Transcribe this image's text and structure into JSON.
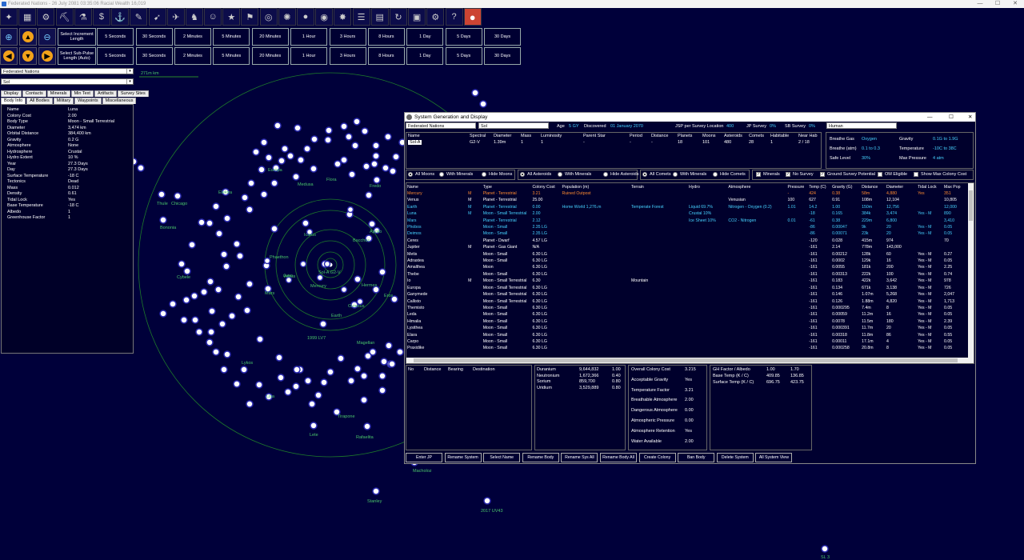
{
  "titlebar": {
    "title": "Federated Nations - 26 July 2081 03:35:06  Racial Wealth 16,019",
    "min": "—",
    "max": "☐",
    "close": "✕"
  },
  "toolbar": {
    "icons": [
      "galaxy-icon",
      "colonies-icon",
      "industry-icon",
      "mining-icon",
      "research-icon",
      "wealth-icon",
      "shipyard-icon",
      "class-design-icon",
      "missile-design-icon",
      "fleet-icon",
      "ground-forces-icon",
      "commanders-icon",
      "medals-icon",
      "intelligence-icon",
      "system-view-icon",
      "galactic-map-icon",
      "planet-icon",
      "habitable-worlds-icon",
      "combat-icon",
      "events-icon",
      "calendar-icon",
      "refresh-icon",
      "save-icon",
      "settings-icon",
      "help-icon",
      "exit-icon"
    ]
  },
  "increment_row": {
    "label": "Select Increment Length",
    "times": [
      "5 Seconds",
      "30 Seconds",
      "2 Minutes",
      "5 Minutes",
      "20 Minutes",
      "1 Hour",
      "3 Hours",
      "8 Hours",
      "1 Day",
      "5 Days",
      "30 Days"
    ]
  },
  "subpulse_row": {
    "label": "Select Sub-Pulse Length (Auto)",
    "times": [
      "5 Seconds",
      "30 Seconds",
      "2 Minutes",
      "5 Minutes",
      "20 Minutes",
      "1 Hour",
      "3 Hours",
      "8 Hours",
      "1 Day",
      "5 Days",
      "30 Days"
    ]
  },
  "left": {
    "race_select": "Federated Nations",
    "system_select": "Sol",
    "tabs_row1": [
      "Display",
      "Contacts",
      "Minerals",
      "Min Text",
      "Artifacts",
      "Survey Sites"
    ],
    "tabs_row2": [
      "Body Info",
      "All Bodies",
      "Military",
      "Waypoints",
      "Miscellaneous"
    ],
    "body_info": [
      [
        "Name",
        "Luna"
      ],
      [
        "Colony Cost",
        "2.00"
      ],
      [
        "Body Type",
        "Moon - Small Terrestrial"
      ],
      [
        "Diameter",
        "3,474 km"
      ],
      [
        "Orbital Distance",
        "384,400 km"
      ],
      [
        "Gravity",
        "0.2 G"
      ],
      [
        "Atmosphere",
        "None"
      ],
      [
        "Hydrosphere",
        "Crustal"
      ],
      [
        "Hydro Extent",
        "10 %"
      ],
      [
        "Year",
        "27.3 Days"
      ],
      [
        "Day",
        "27.3 Days"
      ],
      [
        "Surface Temperature",
        "-18 C"
      ],
      [
        "Tectonics",
        "Dead"
      ],
      [
        "Mass",
        "0.012"
      ],
      [
        "Density",
        "0.61"
      ],
      [
        "Tidal Lock",
        "Yes"
      ],
      [
        "Base Temperature",
        "-18 C"
      ],
      [
        "Albedo",
        "1"
      ],
      [
        "Greenhouse Factor",
        "1"
      ]
    ]
  },
  "map": {
    "scale_label": "271m km",
    "center_label": "Sol-A G2-V",
    "planet_labels": [
      "Mercury",
      "Venus",
      "Earth",
      "Mars",
      "Magellan",
      "1999 LV7",
      "Croesus",
      "Juno",
      "Phaethon",
      "Icarus",
      "Apollo",
      "Bacchus",
      "Hermes",
      "Eros"
    ],
    "labels_far": [
      "Thule",
      "Chicago",
      "Bononia",
      "Cybele",
      "Elektra",
      "Medusa",
      "Flora",
      "Fredo",
      "Lete",
      "Rafaelita",
      "Tirapone",
      "2017 UV43",
      "Stanley",
      "SL 3",
      "Macholoz",
      "Lykos",
      "Lisa",
      "Europa"
    ]
  },
  "sgd": {
    "title": "System Generation and Display",
    "race": "Federated Nations",
    "system": "Sol",
    "age_label": "Age",
    "age_val": "5 GY",
    "discovered_label": "Discovered",
    "discovered_val": "01 January 2070",
    "jsp_label": "JSP per Survey Location",
    "jsp_val": "400",
    "jp_label": "JP Survey",
    "jp_val": "0%",
    "sb_label": "SB Survey",
    "sb_val": "0%",
    "species": "Human",
    "star_headers": [
      "Name",
      "Spectral",
      "Diameter",
      "Mass",
      "Luminosity",
      "Parent Star",
      "Period",
      "Distance",
      "Planets",
      "Moons",
      "Asteroids",
      "Comets",
      "Habitable",
      "Near Hab"
    ],
    "star_row": [
      "Sol-A",
      "G2-V",
      "1.39m",
      "1",
      "1",
      "-",
      "-",
      "-",
      "18",
      "101",
      "480",
      "28",
      "1",
      "2 / 18"
    ],
    "env": {
      "breathe_gas_label": "Breathe Gas",
      "breathe_gas": "Oxygen",
      "gravity_label": "Gravity",
      "gravity": "0.1G  to  1.9G",
      "breathe_atm_label": "Breathe (atm)",
      "breathe_atm": "0.1  to  0.3",
      "temperature_label": "Temperature",
      "temperature": "-10C  to  38C",
      "safe_level_label": "Safe Level",
      "safe_level": "30%",
      "max_pressure_label": "Max Pressure",
      "max_pressure": "4 atm"
    },
    "filters": {
      "moons": [
        "All Moons",
        "With Minerals",
        "Hide Moons"
      ],
      "asteroids": [
        "All Asteroids",
        "With Minerals",
        "Hide Asteroids"
      ],
      "comets": [
        "All Comets",
        "With Minerals",
        "Hide Comets"
      ],
      "checks": [
        "Minerals",
        "No Survey",
        "Ground Survey Potential",
        "OM Eligible",
        "Show Max Colony Cost"
      ]
    },
    "columns": [
      "Name",
      "",
      "Type",
      "Colony Cost",
      "Population (m)",
      "Terrain",
      "Hydro",
      "Atmosphere",
      "Pressure",
      "Temp (C)",
      "Gravity (G)",
      "Distance",
      "Diameter",
      "Tidal Lock",
      "Max Pop"
    ],
    "rows": [
      {
        "c": "orange",
        "v": [
          "Mercury",
          "M",
          "Planet - Terrestrial",
          "3.21",
          "Ruined Outpost",
          "",
          "",
          "",
          "-",
          "424",
          "0.38",
          "58m",
          "4,880",
          "Yes",
          "351"
        ]
      },
      {
        "c": "white",
        "v": [
          "Venus",
          "M",
          "Planet - Terrestrial",
          "25.00",
          "",
          "",
          "",
          "Venusian",
          "100",
          "627",
          "0.91",
          "108m",
          "12,104",
          "",
          "10,805"
        ]
      },
      {
        "c": "cyan",
        "v": [
          "Earth",
          "M",
          "Planet - Terrestrial",
          "0.00",
          "Home World 1,276.m",
          "Temperate Forest",
          "Liquid 69.7%",
          "Nitrogen - Oxygen (0.2)",
          "1.01",
          "14.2",
          "1.00",
          "150m",
          "12,756",
          "",
          "12,000"
        ]
      },
      {
        "c": "cyan",
        "v": [
          "  Luna",
          "M",
          "Moon - Small Terrestrial",
          "2.00",
          "",
          "",
          "Crustal 10%",
          "",
          "",
          "-18",
          "0.165",
          "384k",
          "3,474",
          "Yes - M",
          "890"
        ]
      },
      {
        "c": "cyan",
        "v": [
          "Mars",
          "",
          "Planet - Terrestrial",
          "2.12",
          "",
          "",
          "Ice Sheet 10%",
          "CO2 - Nitrogen",
          "0.01",
          "-61",
          "0.38",
          "229m",
          "6,800",
          "",
          "3,410"
        ]
      },
      {
        "c": "cyan",
        "v": [
          "  Phobos",
          "",
          "Moon - Small",
          "2.35 LG",
          "",
          "",
          "",
          "",
          "",
          "-86",
          "0.00047",
          "9k",
          "20",
          "Yes - M",
          "0.05"
        ]
      },
      {
        "c": "cyan",
        "v": [
          "  Deimos",
          "",
          "Moon - Small",
          "2.35 LG",
          "",
          "",
          "",
          "",
          "",
          "-86",
          "0.00071",
          "23k",
          "20",
          "Yes - M",
          "0.05"
        ]
      },
      {
        "c": "white",
        "v": [
          "Ceres",
          "",
          "Planet - Dwarf",
          "4.57 LG",
          "",
          "",
          "",
          "",
          "",
          "-120",
          "0.028",
          "415m",
          "974",
          "",
          "70"
        ]
      },
      {
        "c": "white",
        "v": [
          "Jupiter",
          "M",
          "Planet - Gas Giant",
          "N/A",
          "",
          "",
          "",
          "",
          "",
          "-161",
          "2.14",
          "778m",
          "143,000",
          "",
          ""
        ]
      },
      {
        "c": "white",
        "v": [
          "  Metis",
          "",
          "Moon - Small",
          "6.30 LG",
          "",
          "",
          "",
          "",
          "",
          "-161",
          "0.00212",
          "128k",
          "60",
          "Yes - M",
          "0.27"
        ]
      },
      {
        "c": "white",
        "v": [
          "  Adrastea",
          "",
          "Moon - Small",
          "6.30 LG",
          "",
          "",
          "",
          "",
          "",
          "-161",
          "0.0002",
          "129k",
          "16",
          "Yes - M",
          "0.05"
        ]
      },
      {
        "c": "white",
        "v": [
          "  Amalthea",
          "",
          "Moon",
          "6.30 LG",
          "",
          "",
          "",
          "",
          "",
          "-161",
          "0.0055",
          "181k",
          "200",
          "Yes - M",
          "2.25"
        ]
      },
      {
        "c": "white",
        "v": [
          "  Thebe",
          "",
          "Moon - Small",
          "6.30 LG",
          "",
          "",
          "",
          "",
          "",
          "-161",
          "0.00313",
          "222k",
          "100",
          "Yes - M",
          "0.74"
        ]
      },
      {
        "c": "white",
        "v": [
          "  Io",
          "M",
          "Moon - Small Terrestrial",
          "6.30",
          "",
          "Mountain",
          "",
          "",
          "",
          "-161",
          "0.183",
          "422k",
          "3,642",
          "Yes - M",
          "978"
        ]
      },
      {
        "c": "white",
        "v": [
          "  Europa",
          "",
          "Moon - Small Terrestrial",
          "6.30 LG",
          "",
          "",
          "",
          "",
          "",
          "-161",
          "0.134",
          "671k",
          "3,138",
          "Yes - M",
          "726"
        ]
      },
      {
        "c": "white",
        "v": [
          "  Ganymede",
          "",
          "Moon - Small Terrestrial",
          "6.30 LG",
          "",
          "",
          "",
          "",
          "",
          "-161",
          "0.146",
          "1.07m",
          "5,268",
          "Yes - M",
          "2,047"
        ]
      },
      {
        "c": "white",
        "v": [
          "  Callisto",
          "",
          "Moon - Small Terrestrial",
          "6.30 LG",
          "",
          "",
          "",
          "",
          "",
          "-161",
          "0.126",
          "1.88m",
          "4,820",
          "Yes - M",
          "1,713"
        ]
      },
      {
        "c": "white",
        "v": [
          "  Themisto",
          "",
          "Moon - Small",
          "6.30 LG",
          "",
          "",
          "",
          "",
          "",
          "-161",
          "0.000295",
          "7.4m",
          "8",
          "Yes - M",
          "0.05"
        ]
      },
      {
        "c": "white",
        "v": [
          "  Leda",
          "",
          "Moon - Small",
          "6.30 LG",
          "",
          "",
          "",
          "",
          "",
          "-161",
          "0.00059",
          "11.2m",
          "16",
          "Yes - M",
          "0.05"
        ]
      },
      {
        "c": "white",
        "v": [
          "  Himalia",
          "",
          "Moon - Small",
          "6.30 LG",
          "",
          "",
          "",
          "",
          "",
          "-161",
          "0.0078",
          "11.5m",
          "180",
          "Yes - M",
          "2.39"
        ]
      },
      {
        "c": "white",
        "v": [
          "  Lysithea",
          "",
          "Moon - Small",
          "6.30 LG",
          "",
          "",
          "",
          "",
          "",
          "-161",
          "0.000391",
          "11.7m",
          "20",
          "Yes - M",
          "0.05"
        ]
      },
      {
        "c": "white",
        "v": [
          "  Elara",
          "",
          "Moon - Small",
          "6.30 LG",
          "",
          "",
          "",
          "",
          "",
          "-161",
          "0.00318",
          "11.8m",
          "86",
          "Yes - M",
          "0.55"
        ]
      },
      {
        "c": "white",
        "v": [
          "  Carpo",
          "",
          "Moon - Small",
          "6.30 LG",
          "",
          "",
          "",
          "",
          "",
          "-161",
          "0.00011",
          "17.1m",
          "4",
          "Yes - M",
          "0.05"
        ]
      },
      {
        "c": "white",
        "v": [
          "  Praxidike",
          "",
          "Moon - Small",
          "6.30 LG",
          "",
          "",
          "",
          "",
          "",
          "-161",
          "0.000258",
          "20.8m",
          "8",
          "Yes - M",
          "0.05"
        ]
      }
    ],
    "jp_headers": [
      "No",
      "Distance",
      "Bearing",
      "Destination"
    ],
    "minerals": [
      [
        "Duranium",
        "9,644,832",
        "1.00"
      ],
      [
        "Neutronium",
        "1,672,366",
        "0.40"
      ],
      [
        "Sorium",
        "859,700",
        "0.80"
      ],
      [
        "Uridium",
        "3,529,889",
        "0.80"
      ]
    ],
    "colony": [
      [
        "Overall Colony Cost",
        "3.215"
      ],
      [
        "Acceptable Gravity",
        "Yes"
      ],
      [
        "Temperature Factor",
        "3.21"
      ],
      [
        "Breathable Atmosphere",
        "2.00"
      ],
      [
        "Dangerous Atmosphere",
        "0.00"
      ],
      [
        "Atmospheric Pressure",
        "0.00"
      ],
      [
        "Atmosphere Retention",
        "Yes"
      ],
      [
        "Water Available",
        "2.00"
      ]
    ],
    "temps": [
      [
        "GH Factor / Albedo",
        "1.00",
        "1.70"
      ],
      [
        "Base Temp (K / C)",
        "409.85",
        "136.85"
      ],
      [
        "Surface Temp (K / C)",
        "696.75",
        "423.75"
      ]
    ],
    "buttons": [
      "Enter JP",
      "Rename System",
      "Select Name",
      "Rename Body",
      "Rename Sys All",
      "Rename Body All",
      "Create Colony",
      "Ban Body",
      "Delete System",
      "All System View"
    ]
  }
}
